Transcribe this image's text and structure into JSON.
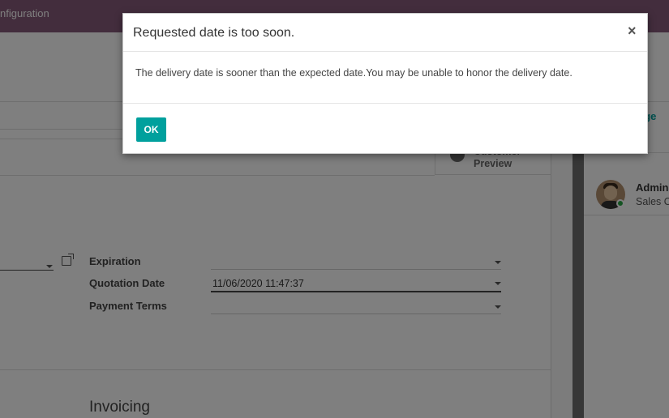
{
  "topbar": {
    "menu_label": "nfiguration"
  },
  "smart_button": {
    "line1": "Customer",
    "line2": "Preview"
  },
  "form": {
    "fields": [
      {
        "label": "Expiration",
        "value": ""
      },
      {
        "label": "Quotation Date",
        "value": "11/06/2020 11:47:37"
      },
      {
        "label": "Payment Terms",
        "value": ""
      }
    ],
    "section_title": "Invoicing"
  },
  "chatter": {
    "page_link": "age",
    "message": {
      "author": "Admini",
      "subtitle": "Sales O"
    }
  },
  "dialog": {
    "title": "Requested date is too soon.",
    "close_symbol": "×",
    "body": "The delivery date is sooner than the expected date.You may be unable to honor the delivery date.",
    "ok_label": "OK"
  },
  "colors": {
    "brand": "#875a7b",
    "accent": "#00a09d",
    "online": "#28a745"
  }
}
